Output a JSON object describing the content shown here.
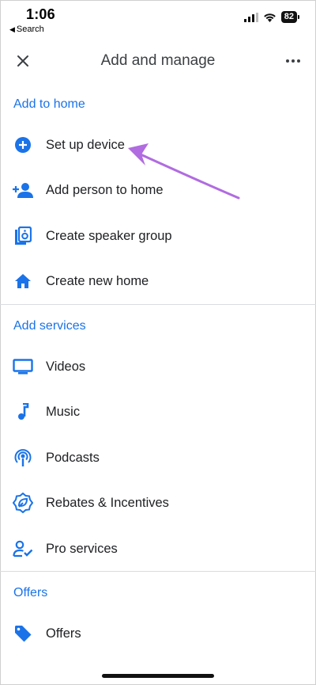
{
  "status_bar": {
    "time": "1:06",
    "back_label": "Search",
    "battery": "82"
  },
  "app_bar": {
    "title": "Add and manage"
  },
  "sections": [
    {
      "header": "Add to home",
      "items": [
        {
          "label": "Set up device",
          "icon": "add-circle-icon"
        },
        {
          "label": "Add person to home",
          "icon": "person-add-icon"
        },
        {
          "label": "Create speaker group",
          "icon": "speaker-icon"
        },
        {
          "label": "Create new home",
          "icon": "home-icon"
        }
      ]
    },
    {
      "header": "Add services",
      "items": [
        {
          "label": "Videos",
          "icon": "tv-icon"
        },
        {
          "label": "Music",
          "icon": "music-note-icon"
        },
        {
          "label": "Podcasts",
          "icon": "podcast-icon"
        },
        {
          "label": "Rebates & Incentives",
          "icon": "eco-badge-icon"
        },
        {
          "label": "Pro services",
          "icon": "person-check-icon"
        }
      ]
    },
    {
      "header": "Offers",
      "items": [
        {
          "label": "Offers",
          "icon": "tag-icon"
        }
      ]
    }
  ],
  "colors": {
    "accent": "#1a73e8",
    "annotation_arrow": "#b06ce0"
  }
}
